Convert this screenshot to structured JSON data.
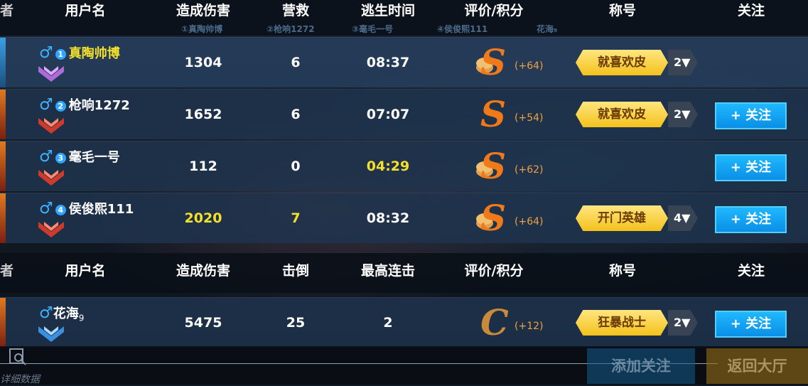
{
  "team_table": {
    "headers": [
      "用户名",
      "造成伤害",
      "营救",
      "逃生时间",
      "评价/积分",
      "称号",
      "关注"
    ],
    "header_left_fragment": "者",
    "subrow_names": [
      "①真陶帅博",
      "②枪响1272",
      "③毫毛一号",
      "④侯俊熙111",
      "花海₉"
    ],
    "rows": [
      {
        "index": "1",
        "name": "真陶帅博",
        "damage": "1304",
        "rescue": "6",
        "escape_time": "08:37",
        "grade": "S",
        "points": "(+64)",
        "title": "就喜欢皮",
        "title_level": "2▼",
        "follow": ""
      },
      {
        "index": "2",
        "name": "枪响1272",
        "damage": "1652",
        "rescue": "6",
        "escape_time": "07:07",
        "grade": "S",
        "points": "(+54)",
        "title": "就喜欢皮",
        "title_level": "2▼",
        "follow": "+ 关注"
      },
      {
        "index": "3",
        "name": "毫毛一号",
        "damage": "112",
        "rescue": "0",
        "escape_time": "04:29",
        "grade": "S",
        "points": "(+62)",
        "title": "",
        "title_level": "",
        "follow": "+ 关注"
      },
      {
        "index": "4",
        "name": "侯俊熙111",
        "damage": "2020",
        "rescue": "7",
        "escape_time": "08:32",
        "grade": "S",
        "points": "(+64)",
        "title": "开门英雄",
        "title_level": "4▼",
        "follow": "+ 关注"
      }
    ]
  },
  "enemy_table": {
    "headers": [
      "用户名",
      "造成伤害",
      "击倒",
      "最高连击",
      "评价/积分",
      "称号",
      "关注"
    ],
    "header_left_fragment": "者",
    "rows": [
      {
        "name": "花海",
        "name_sub": "9",
        "damage": "5475",
        "knockdowns": "25",
        "max_combo": "2",
        "grade": "C",
        "points": "(+12)",
        "title": "狂暴战士",
        "title_level": "2▼",
        "follow": "+ 关注"
      }
    ]
  },
  "footer": {
    "detail_label": "详细数据",
    "add_follow_label": "添加关注",
    "back_label": "返回大厅"
  },
  "colors": {
    "highlight_yellow": "#f5e12a",
    "follow_blue": "#1fb8ff",
    "title_gold": "#f4c21c",
    "grade_orange": "#f07a1a",
    "grade_bronze": "#c98a3a"
  }
}
